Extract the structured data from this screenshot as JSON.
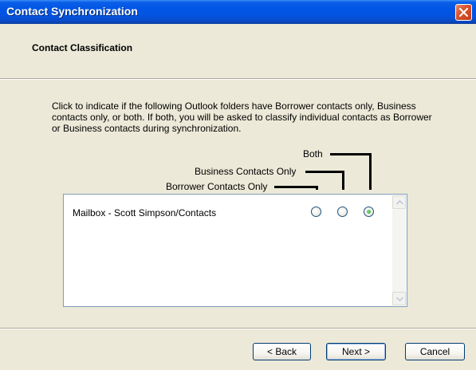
{
  "window": {
    "title": "Contact Synchronization"
  },
  "header": {
    "title": "Contact Classification"
  },
  "instructions": "Click to indicate if the following Outlook folders have Borrower contacts only, Business contacts only, or both. If both, you will be asked to classify individual contacts as Borrower or Business contacts during synchronization.",
  "columns": {
    "both": "Both",
    "business": "Business Contacts Only",
    "borrower": "Borrower Contacts Only"
  },
  "folders": [
    {
      "name": "Mailbox - Scott Simpson/Contacts",
      "selected": "both"
    }
  ],
  "buttons": {
    "back": "< Back",
    "next": "Next >",
    "cancel": "Cancel"
  },
  "colors": {
    "titlebar": "#0055e5",
    "selected_radio": "#21a121"
  }
}
